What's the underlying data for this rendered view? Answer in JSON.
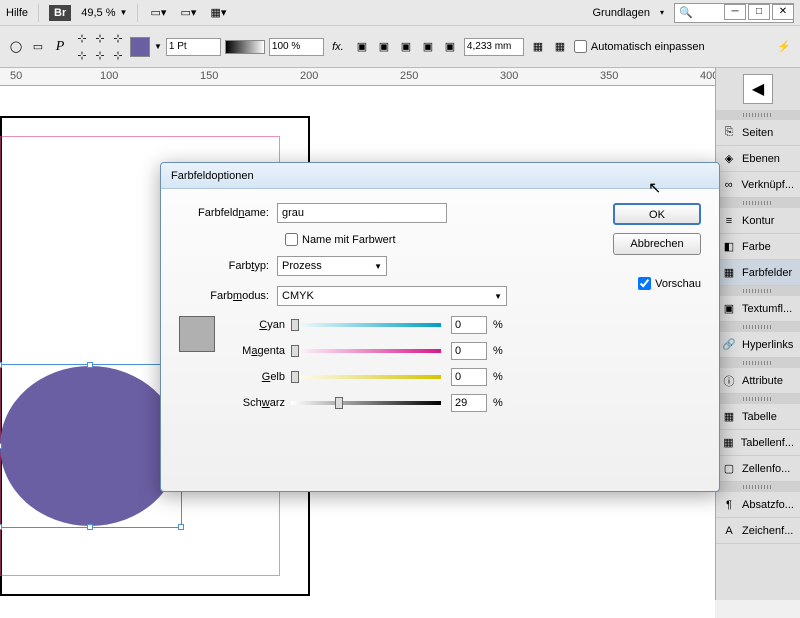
{
  "topbar": {
    "help": "Hilfe",
    "bridge": "Br",
    "zoom": "49,5 %",
    "workspace_label": "Grundlagen"
  },
  "toolbar": {
    "stroke_weight": "1 Pt",
    "opacity": "100 %",
    "measure": "4,233 mm",
    "autofit": "Automatisch einpassen"
  },
  "ruler": {
    "t50": "50",
    "t100": "100",
    "t150": "150",
    "t200": "200",
    "t250": "250",
    "t300": "300",
    "t350": "350",
    "t400": "400"
  },
  "panels": {
    "seiten": "Seiten",
    "ebenen": "Ebenen",
    "verknuepf": "Verknüpf...",
    "kontur": "Kontur",
    "farbe": "Farbe",
    "farbfelder": "Farbfelder",
    "textumfl": "Textumfl...",
    "hyperlinks": "Hyperlinks",
    "attribute": "Attribute",
    "tabelle": "Tabelle",
    "tabellenf": "Tabellenf...",
    "zellenfo": "Zellenfo...",
    "absatzfo": "Absatzfo...",
    "zeichenfo": "Zeichenf..."
  },
  "dialog": {
    "title": "Farbfeldoptionen",
    "name_label": "Farbfeldname:",
    "name_value": "grau",
    "name_with_value": "Name mit Farbwert",
    "type_label": "Farbtyp:",
    "type_value": "Prozess",
    "mode_label": "Farbmodus:",
    "mode_value": "CMYK",
    "ok": "OK",
    "cancel": "Abbrechen",
    "preview": "Vorschau",
    "sliders": {
      "cyan": {
        "label": "Cyan",
        "value": "0",
        "pct": "%"
      },
      "magenta": {
        "label": "Magenta",
        "value": "0",
        "pct": "%"
      },
      "yellow": {
        "label": "Gelb",
        "value": "0",
        "pct": "%"
      },
      "black": {
        "label": "Schwarz",
        "value": "29",
        "pct": "%"
      }
    }
  }
}
